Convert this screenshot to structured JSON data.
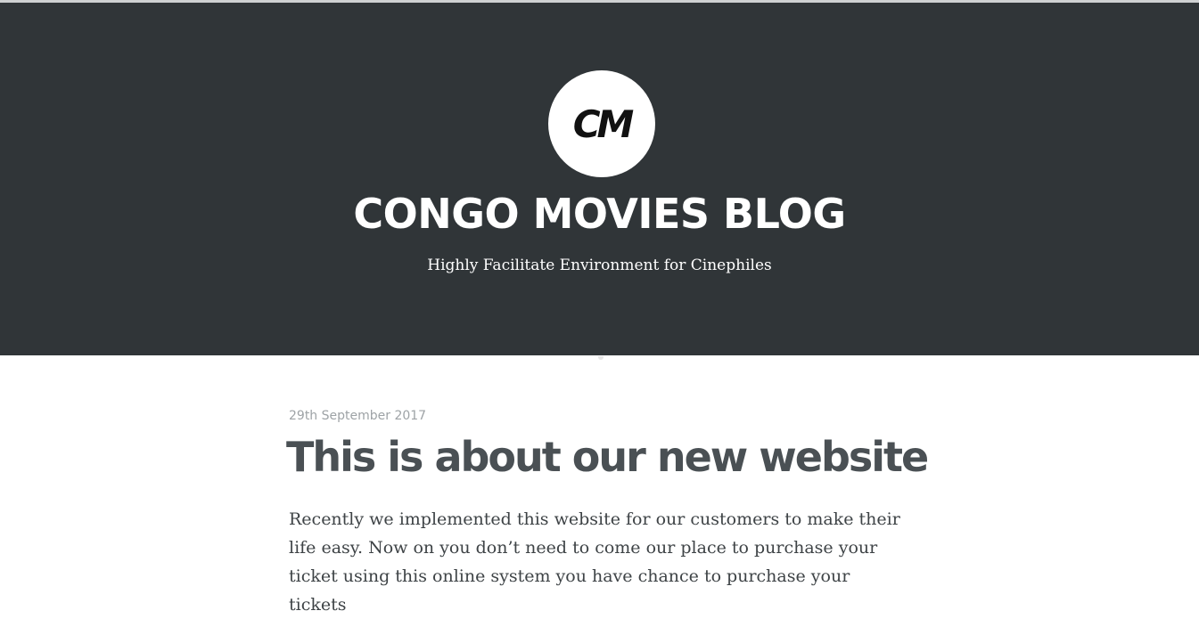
{
  "header": {
    "logo_text": "CM",
    "title": "CONGO MOVIES BLOG",
    "description": "Highly Facilitate Environment for Cinephiles",
    "background_color": "#303538"
  },
  "post": {
    "date": "29th September 2017",
    "title": "This is about our new website",
    "body": "Recently we implemented this website for our customers to make their life easy. Now on you don’t need to come our place to purchase your ticket using this online system you have chance to purchase your tickets"
  }
}
